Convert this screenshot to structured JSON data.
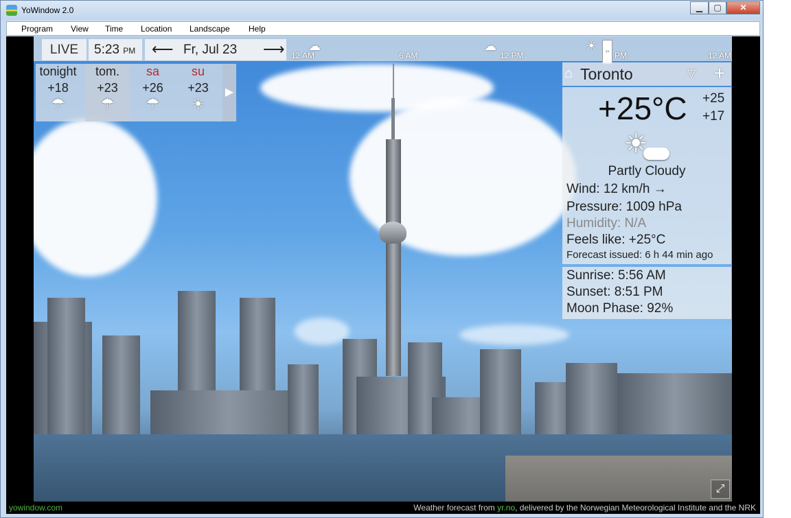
{
  "window": {
    "title": "YoWindow 2.0",
    "minimize": "▁",
    "maximize": "▢",
    "close": "✕"
  },
  "menu": [
    "Program",
    "View",
    "Time",
    "Location",
    "Landscape",
    "Help"
  ],
  "topbar": {
    "live": "LIVE",
    "time": "5:23",
    "ampm": "PM",
    "prev_arrow": "⟵",
    "date": "Fr, Jul 23",
    "next_arrow": "⟶",
    "timeline_labels": [
      "12 AM",
      "6 AM",
      "12 PM",
      "PM",
      "12 AM"
    ],
    "slider_icon": "‹›"
  },
  "forecast": [
    {
      "name": "tonight",
      "temp": "+18",
      "icon": "rain-cloud-icon",
      "glyph": "☂",
      "weekend": false
    },
    {
      "name": "tom.",
      "temp": "+23",
      "icon": "rain-cloud-icon",
      "glyph": "☂",
      "weekend": false
    },
    {
      "name": "sa",
      "temp": "+26",
      "icon": "rain-cloud-icon",
      "glyph": "☂",
      "weekend": true
    },
    {
      "name": "su",
      "temp": "+23",
      "icon": "sun-icon",
      "glyph": "☀",
      "weekend": true
    }
  ],
  "forecast_next": "▶",
  "panel": {
    "city": "Toronto",
    "temp": "+25°C",
    "high": "+25",
    "low": "+17",
    "condition": "Partly Cloudy",
    "wind": "Wind:  12 km/h  →",
    "pressure": "Pressure:  1009 hPa",
    "humidity": "Humidity:  N/A",
    "feels": "Feels like:  +25°C",
    "issued": "Forecast issued:  6 h 44 min ago",
    "sunrise": "Sunrise:   5:56 AM",
    "sunset": "Sunset:   8:51 PM",
    "moon": "Moon Phase:  92%"
  },
  "footer": {
    "site": "yowindow.com",
    "credit_prefix": "Weather forecast from ",
    "credit_link": "yr.no",
    "credit_suffix": ", delivered by the Norwegian Meteorological Institute and the NRK"
  },
  "colors": {
    "accent_green": "#4fb33f",
    "weekend_red": "#b03030",
    "sky": "#3d86d8"
  }
}
